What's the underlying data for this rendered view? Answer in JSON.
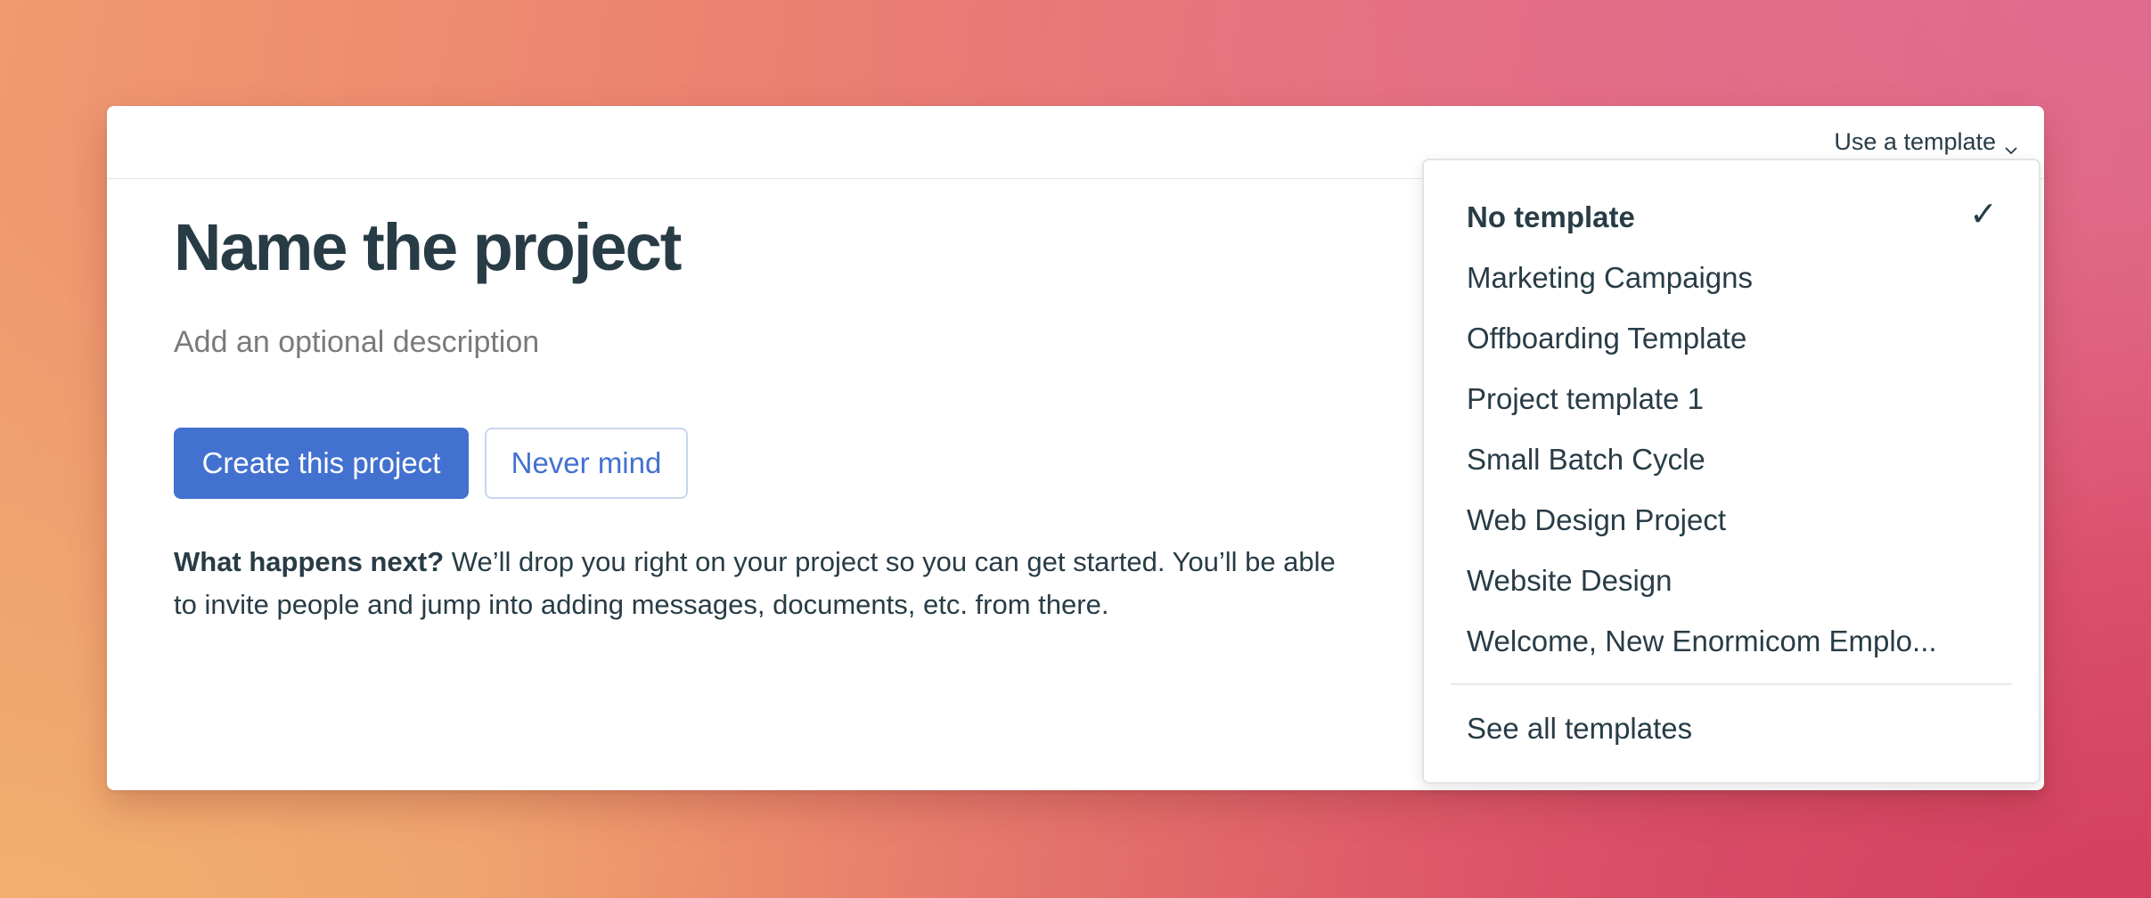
{
  "header": {
    "template_toggle_label": "Use a template"
  },
  "form": {
    "title": "Name the project",
    "description_placeholder": "Add an optional description",
    "create_button": "Create this project",
    "cancel_button": "Never mind",
    "next_heading": "What happens next?",
    "next_body": "We’ll drop you right on your project so you can get started. You’ll be able to invite people and jump into adding messages, documents, etc. from there."
  },
  "template_menu": {
    "selected_index": 0,
    "check_glyph": "✓",
    "items": [
      {
        "label": "No template"
      },
      {
        "label": "Marketing Campaigns"
      },
      {
        "label": "Offboarding Template"
      },
      {
        "label": "Project template 1"
      },
      {
        "label": "Small Batch Cycle"
      },
      {
        "label": "Web Design Project"
      },
      {
        "label": "Website Design"
      },
      {
        "label": "Welcome, New Enormicom Emplo..."
      }
    ],
    "see_all": "See all templates"
  },
  "colors": {
    "primary": "#4371d0",
    "text": "#283c46",
    "muted": "#7a7a7a"
  }
}
